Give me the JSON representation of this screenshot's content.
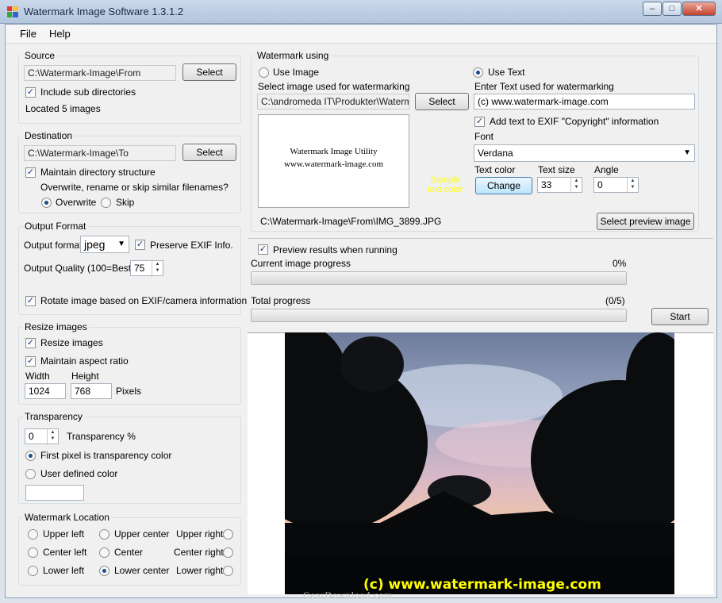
{
  "window": {
    "title": "Watermark Image Software 1.3.1.2",
    "min": "–",
    "max": "□",
    "close": "✕"
  },
  "menu": {
    "file": "File",
    "help": "Help"
  },
  "source": {
    "label": "Source",
    "path": "C:\\Watermark-Image\\From",
    "select": "Select",
    "include_sub": "Include sub directories",
    "located": "Located 5 images"
  },
  "destination": {
    "label": "Destination",
    "path": "C:\\Watermark-Image\\To",
    "select": "Select",
    "maintain": "Maintain directory structure",
    "question": "Overwrite, rename or skip similar filenames?",
    "overwrite": "Overwrite",
    "skip": "Skip"
  },
  "output": {
    "label": "Output Format",
    "format_label": "Output format",
    "format_value": "jpeg",
    "preserve_exif": "Preserve EXIF Info.",
    "quality_label": "Output Quality (100=Best)",
    "quality_value": "75",
    "rotate": "Rotate image based on EXIF/camera information"
  },
  "resize": {
    "label": "Resize images",
    "resize": "Resize images",
    "aspect": "Maintain aspect ratio",
    "width_label": "Width",
    "height_label": "Height",
    "width": "1024",
    "height": "768",
    "unit": "Pixels"
  },
  "transparency": {
    "label": "Transparency",
    "value": "0",
    "pct_label": "Transparency %",
    "first_pixel": "First pixel is transparency color",
    "user_defined": "User defined color"
  },
  "location": {
    "label": "Watermark Location",
    "upper_left": "Upper left",
    "upper_center": "Upper center",
    "upper_right": "Upper right",
    "center_left": "Center left",
    "center": "Center",
    "center_right": "Center right",
    "lower_left": "Lower left",
    "lower_center": "Lower center",
    "lower_right": "Lower right"
  },
  "watermark": {
    "label": "Watermark using",
    "use_image": "Use Image",
    "use_text": "Use Text",
    "select_image_label": "Select image used for watermarking",
    "image_path": "C:\\andromeda IT\\Produkter\\Watermark",
    "select": "Select",
    "preview_line1": "Watermark Image Utility",
    "preview_line2": "www.watermark-image.com",
    "enter_text_label": "Enter Text used for watermarking",
    "text_value": "(c) www.watermark-image.com",
    "exif_copyright": "Add text to EXIF \"Copyright\" information",
    "font_label": "Font",
    "font_value": "Verdana",
    "text_color_label": "Text color",
    "sample1": "Sample",
    "sample2": "text color",
    "change": "Change",
    "text_size_label": "Text size",
    "text_size": "33",
    "angle_label": "Angle",
    "angle": "0",
    "file_path": "C:\\Watermark-Image\\From\\IMG_3899.JPG",
    "select_preview": "Select preview image"
  },
  "progress": {
    "preview_running": "Preview results when running",
    "current_label": "Current image progress",
    "current_pct": "0%",
    "current_value": 0,
    "total_label": "Total progress",
    "total_count": "(0/5)",
    "total_value": 0,
    "start": "Start"
  },
  "photo": {
    "watermark_text": "(c) www.watermark-image.com"
  },
  "site_watermark": "GearDownload.com",
  "colors": {
    "sample_text": "#ffff00",
    "watermark_text": "#ffff00",
    "title_text": "#1b2a44"
  }
}
